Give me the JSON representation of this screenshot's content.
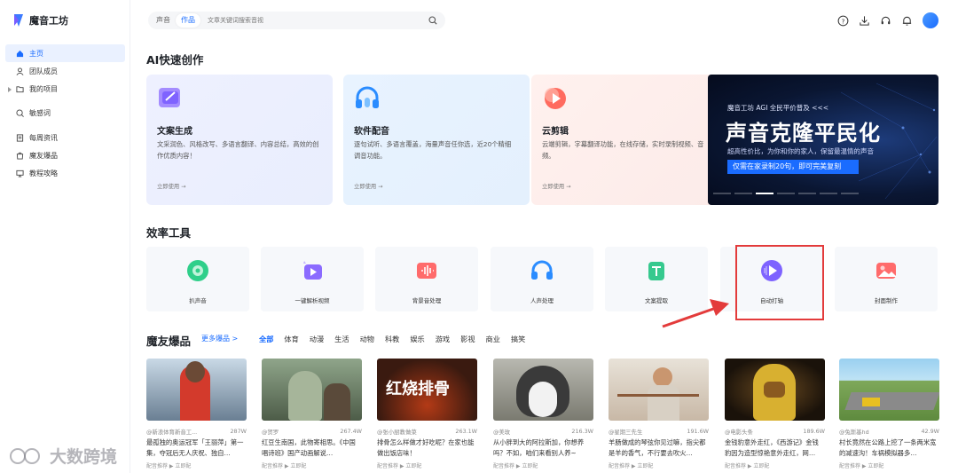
{
  "app": {
    "name": "魔音工坊"
  },
  "sidebar": {
    "items": [
      {
        "label": "主页",
        "icon": "home-icon",
        "active": true
      },
      {
        "label": "团队成员",
        "icon": "user-icon"
      },
      {
        "label": "我的项目",
        "icon": "folder-icon"
      },
      {
        "label": "敏感词",
        "icon": "search-word-icon"
      },
      {
        "label": "每周资讯",
        "icon": "news-icon"
      },
      {
        "label": "魔友爆品",
        "icon": "bag-icon"
      },
      {
        "label": "教程攻略",
        "icon": "monitor-icon"
      }
    ]
  },
  "search": {
    "tabs": [
      "声音",
      "作品"
    ],
    "active_tab": "作品",
    "placeholder": "文章关键词搜索音视"
  },
  "sections": {
    "ai": "AI快速创作",
    "tools": "效率工具",
    "moyou": "魔友爆品",
    "more": "更多爆品 >"
  },
  "ai_cards": [
    {
      "title": "文案生成",
      "desc": "文采润色、风格改写、多语言翻译、内容总结，高效的创作优质内容！",
      "link": "立即使用 →"
    },
    {
      "title": "软件配音",
      "desc": "逐句试听、多语言覆盖，海量声音任你选，近20个精细调音功能。",
      "link": "立即使用 →"
    },
    {
      "title": "云剪辑",
      "desc": "云端剪辑，字幕翻译功能，在线存储，实时录制视频、音频。",
      "link": "立即使用 →"
    }
  ],
  "banner": {
    "line1": "魔音工坊 AGI 全民平价普及 <<<",
    "line2": "声音克隆平民化",
    "line3": "超高性价比，为你和你的家人，保留最温情的声音",
    "cta": "仅需在家录制20句，即可完美复刻"
  },
  "tools": [
    {
      "label": "扒声音"
    },
    {
      "label": "一键解析视频"
    },
    {
      "label": "背景音处理"
    },
    {
      "label": "人声处理"
    },
    {
      "label": "文案提取"
    },
    {
      "label": "自动打轴"
    },
    {
      "label": "封面制作"
    }
  ],
  "categories": [
    "全部",
    "体育",
    "动漫",
    "生活",
    "动物",
    "科教",
    "娱乐",
    "游戏",
    "影视",
    "商业",
    "搞笑"
  ],
  "active_category": "全部",
  "videos": [
    {
      "author": "@新浪体育新音工...",
      "likes": "287W",
      "title": "最孤独的奥运冠军「王丽萍」第一集，夺冠后无人庆祝、独自…",
      "foot": "配音推荐  ▶ 立即配"
    },
    {
      "author": "@贺罗",
      "likes": "267.4W",
      "title": "红豆生南国，此物寄相思。《中国唱诗班》国产动画解说…",
      "foot": "配音推荐  ▶ 立即配"
    },
    {
      "author": "@张小厨教做菜",
      "likes": "263.1W",
      "title": "排骨怎么样做才好吃呢？在家也能做出饭店味！",
      "foot": "配音推荐  ▶ 立即配"
    },
    {
      "author": "@美玫",
      "likes": "216.3W",
      "title": "从小胖到大的阿拉斯加，你想养吗？不如，咱们来看别人养~",
      "foot": "配音推荐  ▶ 立即配"
    },
    {
      "author": "@星期三先生",
      "likes": "191.6W",
      "title": "羊肠做成的琴弦你见过嘛，指尖都是羊的香气，不行要去吹火…",
      "foot": "配音推荐  ▶ 立即配"
    },
    {
      "author": "@电影头条",
      "likes": "189.6W",
      "title": "金钱豹意外走红，《西游记》金钱豹因为造型惊艳意外走红，网…",
      "foot": "配音推荐  ▶ 立即配"
    },
    {
      "author": "@兔斯基hd",
      "likes": "42.9W",
      "title": "村长竟然在公路上挖了一条两米宽的减速沟！车祸模拟器多…",
      "foot": "配音推荐  ▶ 立即配"
    }
  ],
  "watermark": "大数跨境"
}
